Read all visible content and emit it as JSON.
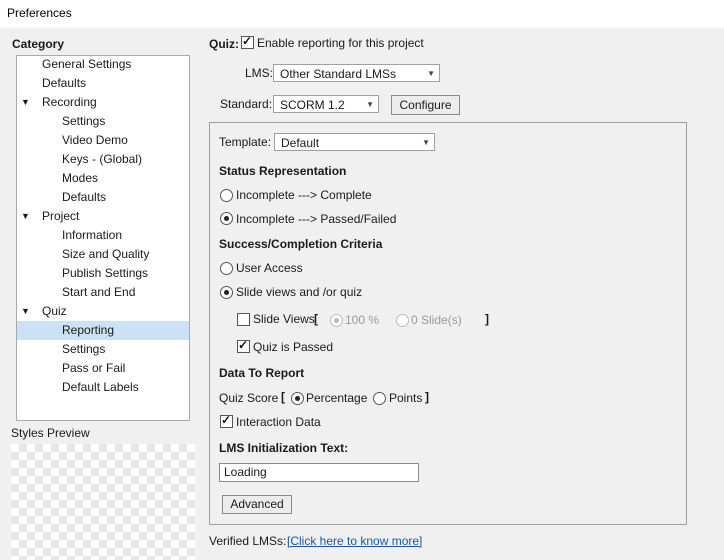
{
  "window": {
    "title": "Preferences"
  },
  "sidebar": {
    "heading": "Category",
    "items": [
      {
        "label": "General Settings"
      },
      {
        "label": "Defaults"
      },
      {
        "label": "Recording"
      },
      {
        "label": "Settings"
      },
      {
        "label": "Video Demo"
      },
      {
        "label": "Keys - (Global)"
      },
      {
        "label": "Modes"
      },
      {
        "label": "Defaults"
      },
      {
        "label": "Project"
      },
      {
        "label": "Information"
      },
      {
        "label": "Size and Quality"
      },
      {
        "label": "Publish Settings"
      },
      {
        "label": "Start and End"
      },
      {
        "label": "Quiz"
      },
      {
        "label": "Reporting"
      },
      {
        "label": "Settings"
      },
      {
        "label": "Pass or Fail"
      },
      {
        "label": "Default Labels"
      }
    ],
    "styles_preview_label": "Styles Preview"
  },
  "quiz": {
    "label": "Quiz:",
    "enable_reporting_label": "Enable reporting for this project",
    "lms_label": "LMS:",
    "lms_value": "Other Standard LMSs",
    "standard_label": "Standard:",
    "standard_value": "SCORM 1.2",
    "configure_label": "Configure"
  },
  "panel": {
    "template_label": "Template:",
    "template_value": "Default",
    "status_heading": "Status Representation",
    "status_opt1": "Incomplete ---> Complete",
    "status_opt2": "Incomplete ---> Passed/Failed",
    "success_heading": "Success/Completion Criteria",
    "user_access_label": "User Access",
    "slide_views_quiz_label": "Slide views and /or quiz",
    "slide_views_label": "Slide Views",
    "bracket_open": "[",
    "bracket_close": "]",
    "percent_value": "100 %",
    "slides_value": "0 Slide(s)",
    "quiz_passed_label": "Quiz is Passed",
    "data_heading": "Data To Report",
    "quiz_score_label": "Quiz Score",
    "percentage_label": "Percentage",
    "points_label": "Points",
    "interaction_label": "Interaction Data",
    "lms_init_heading": "LMS Initialization Text:",
    "lms_init_value": "Loading",
    "advanced_label": "Advanced"
  },
  "footer": {
    "verified_label": "Verified LMSs:",
    "link_text": "[Click here to know more]"
  }
}
